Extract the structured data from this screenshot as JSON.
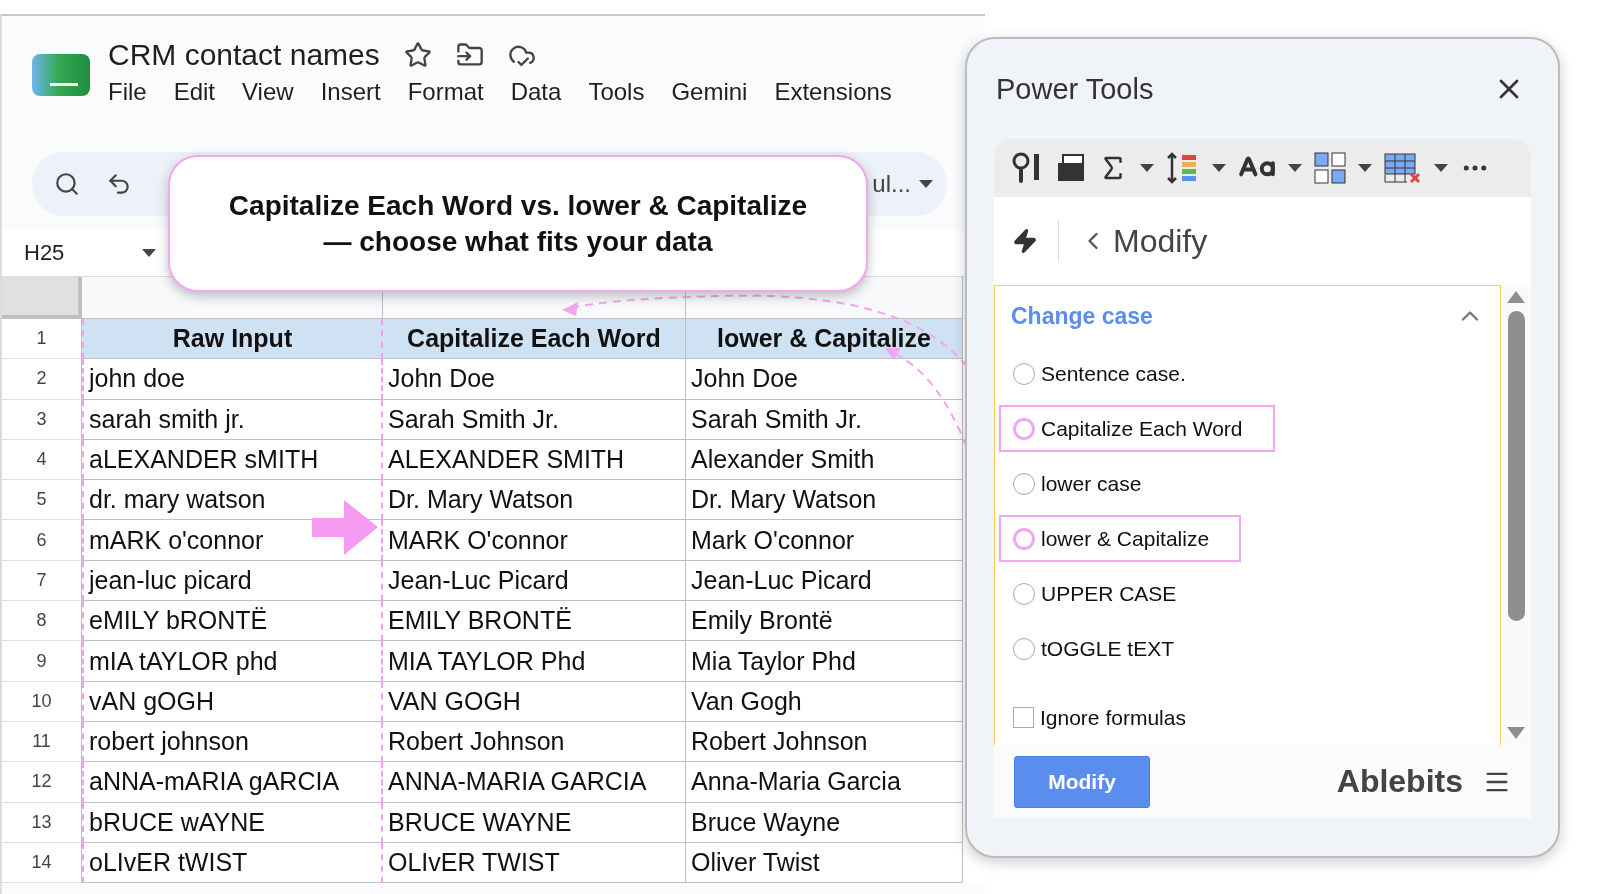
{
  "app": {
    "title": "CRM contact names",
    "menu": [
      "File",
      "Edit",
      "View",
      "Insert",
      "Format",
      "Data",
      "Tools",
      "Gemini",
      "Extensions"
    ]
  },
  "toolbar": {
    "font_name": "ul..."
  },
  "name_box": "H25",
  "callout": {
    "lines": [
      "Capitalize Each Word vs. lower & Capitalize",
      "— choose what fits your data"
    ]
  },
  "table": {
    "header_number": "1",
    "columns": [
      "Raw Input",
      "Capitalize Each Word",
      "lower & Capitalize"
    ],
    "rows": [
      {
        "number": "2",
        "cells": [
          "john doe",
          "John Doe",
          "John Doe"
        ]
      },
      {
        "number": "3",
        "cells": [
          "sarah smith jr.",
          "Sarah Smith Jr.",
          "Sarah Smith Jr."
        ]
      },
      {
        "number": "4",
        "cells": [
          "aLEXANDER sMITH",
          "ALEXANDER SMITH",
          "Alexander Smith"
        ]
      },
      {
        "number": "5",
        "cells": [
          "dr. mary watson",
          "Dr. Mary Watson",
          "Dr. Mary Watson"
        ]
      },
      {
        "number": "6",
        "cells": [
          "mARK o'connor",
          "MARK O'connor",
          "Mark O'connor"
        ]
      },
      {
        "number": "7",
        "cells": [
          "jean-luc picard",
          "Jean-Luc Picard",
          "Jean-Luc Picard"
        ]
      },
      {
        "number": "8",
        "cells": [
          "eMILY bRONTË",
          "EMILY BRONTË",
          "Emily Brontë"
        ]
      },
      {
        "number": "9",
        "cells": [
          "mIA tAYLOR phd",
          "MIA TAYLOR Phd",
          "Mia Taylor Phd"
        ]
      },
      {
        "number": "10",
        "cells": [
          "vAN gOGH",
          "VAN GOGH",
          "Van Gogh"
        ]
      },
      {
        "number": "11",
        "cells": [
          "robert johnson",
          "Robert Johnson",
          "Robert Johnson"
        ]
      },
      {
        "number": "12",
        "cells": [
          "aNNA-mARIA gARCIA",
          "ANNA-MARIA GARCIA",
          "Anna-Maria Garcia"
        ]
      },
      {
        "number": "13",
        "cells": [
          "bRUCE wAYNE",
          "BRUCE WAYNE",
          "Bruce Wayne"
        ]
      },
      {
        "number": "14",
        "cells": [
          "oLIvER tWIST",
          "OLIvER TWIST",
          "Oliver Twist"
        ]
      }
    ]
  },
  "panel": {
    "title": "Power Tools",
    "nav": "Modify",
    "section": {
      "title": "Change case",
      "expanded": true,
      "options": [
        {
          "label": "Sentence case.",
          "highlighted": false
        },
        {
          "label": "Capitalize Each Word",
          "highlighted": true
        },
        {
          "label": "lower case",
          "highlighted": false
        },
        {
          "label": "lower & Capitalize",
          "highlighted": true
        },
        {
          "label": "UPPER CASE",
          "highlighted": false
        },
        {
          "label": "tOGGLE tEXT",
          "highlighted": false
        }
      ],
      "checkbox": {
        "label": "Ignore formulas",
        "checked": false
      }
    },
    "button": "Modify",
    "brand": "Ablebits"
  }
}
